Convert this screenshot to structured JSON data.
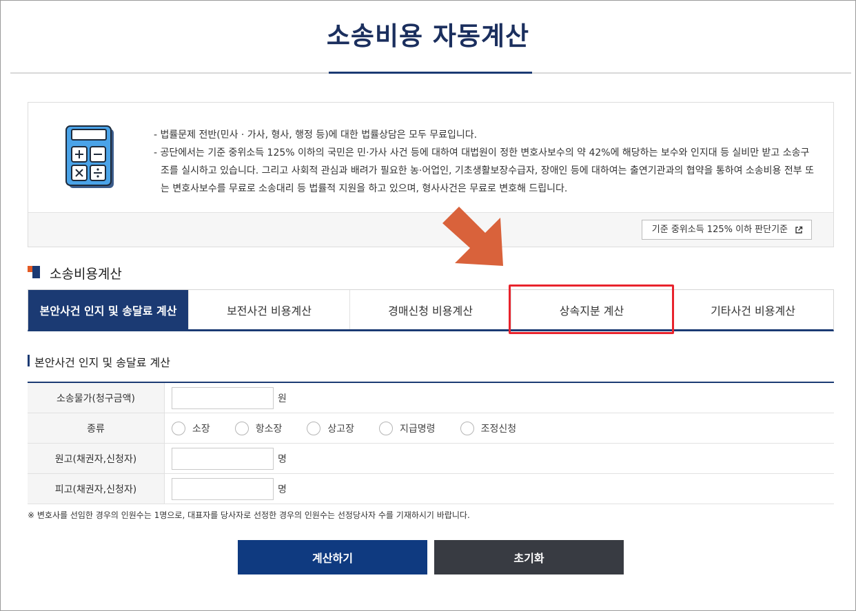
{
  "header": {
    "title": "소송비용 자동계산"
  },
  "info": {
    "lines": [
      "- 법률문제 전반(민사 · 가사, 형사, 행정 등)에 대한 법률상담은 모두 무료입니다.",
      "- 공단에서는 기준 중위소득 125% 이하의 국민은 민·가사 사건 등에 대하여 대법원이 정한 변호사보수의 약 42%에 해당하는 보수와 인지대 등 실비만 받고 소송구조를 실시하고 있습니다. 그리고 사회적 관심과 배려가 필요한 농·어업인, 기초생활보장수급자, 장애인 등에 대하여는 출연기관과의 협약을 통하여 소송비용 전부 또는 변호사보수를 무료로 소송대리 등 법률적 지원을 하고 있으며, 형사사건은 무료로 변호해 드립니다."
    ],
    "criteria_button": "기준 중위소득 125% 이하 판단기준",
    "icons": {
      "main": "calculator-icon",
      "link": "external-link-icon"
    }
  },
  "section": {
    "title": "소송비용계산"
  },
  "tabs": [
    {
      "label": "본안사건 인지 및 송달료 계산",
      "active": true
    },
    {
      "label": "보전사건 비용계산",
      "active": false
    },
    {
      "label": "경매신청 비용계산",
      "active": false
    },
    {
      "label": "상속지분 계산",
      "active": false
    },
    {
      "label": "기타사건 비용계산",
      "active": false
    }
  ],
  "form": {
    "title": "본안사건 인지 및 송달료 계산",
    "rows": {
      "amount": {
        "label": "소송물가(청구금액)",
        "value": "",
        "unit": "원"
      },
      "kind": {
        "label": "종류",
        "options": [
          "소장",
          "항소장",
          "상고장",
          "지급명령",
          "조정신청"
        ]
      },
      "plaintiff": {
        "label": "원고(채권자,신청자)",
        "value": "",
        "unit": "명"
      },
      "defendant": {
        "label": "피고(채권자,신청자)",
        "value": "",
        "unit": "명"
      }
    },
    "note": "※ 변호사를 선임한 경우의 인원수는 1명으로, 대표자를 당사자로 선정한 경우의 인원수는 선정당사자 수를 기재하시기 바랍니다."
  },
  "buttons": {
    "calculate": "계산하기",
    "reset": "초기화"
  },
  "colors": {
    "primary": "#1b3a73",
    "button_primary": "#0f3a80",
    "button_dark": "#383b42",
    "highlight": "#e8232c",
    "arrow": "#d9623b",
    "accent": "#e35a24"
  }
}
